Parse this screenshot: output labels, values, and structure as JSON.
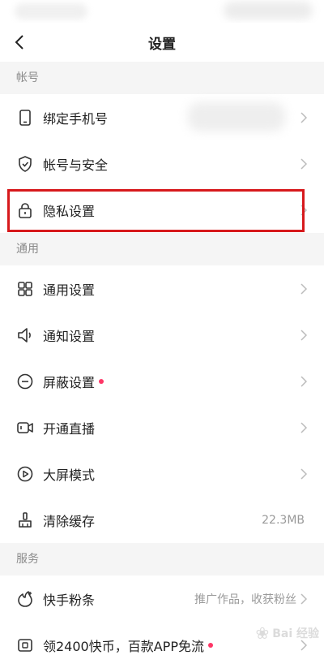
{
  "header": {
    "title": "设置"
  },
  "sections": [
    {
      "title": "帐号",
      "items": [
        {
          "label": "绑定手机号",
          "icon": "phone-icon"
        },
        {
          "label": "帐号与安全",
          "icon": "shield-icon"
        },
        {
          "label": "隐私设置",
          "icon": "lock-icon",
          "highlighted": true
        }
      ]
    },
    {
      "title": "通用",
      "items": [
        {
          "label": "通用设置",
          "icon": "grid-icon"
        },
        {
          "label": "通知设置",
          "icon": "speaker-icon"
        },
        {
          "label": "屏蔽设置",
          "icon": "minus-circle-icon",
          "badge_dot": true
        },
        {
          "label": "开通直播",
          "icon": "video-camera-icon"
        },
        {
          "label": "大屏模式",
          "icon": "play-screen-icon"
        },
        {
          "label": "清除缓存",
          "icon": "broom-icon",
          "value": "22.3MB"
        }
      ]
    },
    {
      "title": "服务",
      "items": [
        {
          "label": "快手粉条",
          "icon": "promo-icon",
          "value": "推广作品，收获粉丝"
        },
        {
          "label": "领2400快币，百款APP免流",
          "icon": "sim-card-icon",
          "badge_dot": true
        }
      ]
    }
  ],
  "colors": {
    "highlight_border": "#d7191c",
    "badge_dot": "#fe3666",
    "section_bg": "#f5f5f5"
  },
  "watermark": {
    "text": "Bai 经验"
  }
}
